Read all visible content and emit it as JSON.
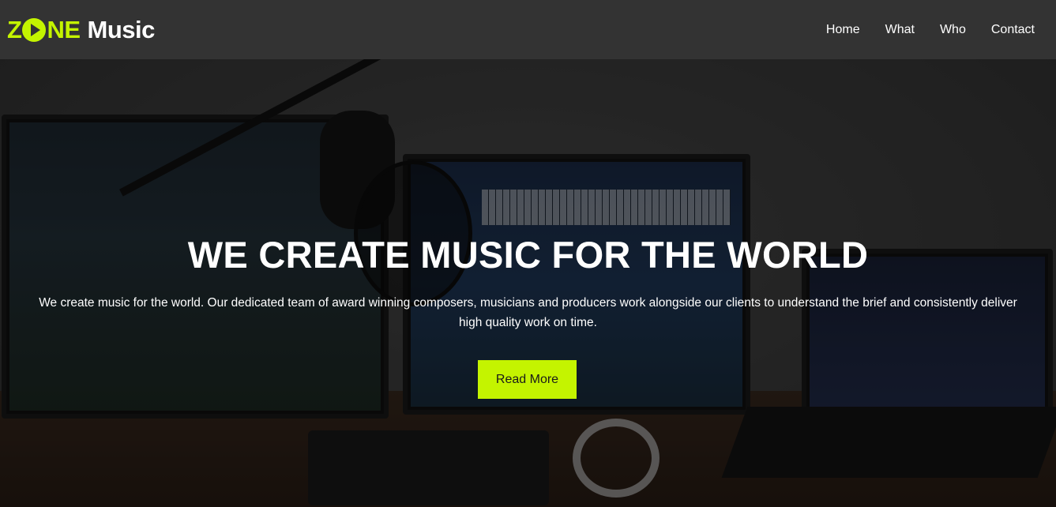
{
  "brand": {
    "logo_zone_z": "Z",
    "logo_zone_ne": "NE",
    "logo_music": "Music",
    "accent_color": "#c4f400"
  },
  "nav": {
    "items": [
      {
        "label": "Home"
      },
      {
        "label": "What"
      },
      {
        "label": "Who"
      },
      {
        "label": "Contact"
      }
    ]
  },
  "hero": {
    "title": "WE CREATE MUSIC FOR THE WORLD",
    "text": "We create music for the world. Our dedicated team of award winning composers, musicians and producers work alongside our clients to understand the brief and consistently deliver high quality work on time.",
    "button_label": "Read More"
  }
}
